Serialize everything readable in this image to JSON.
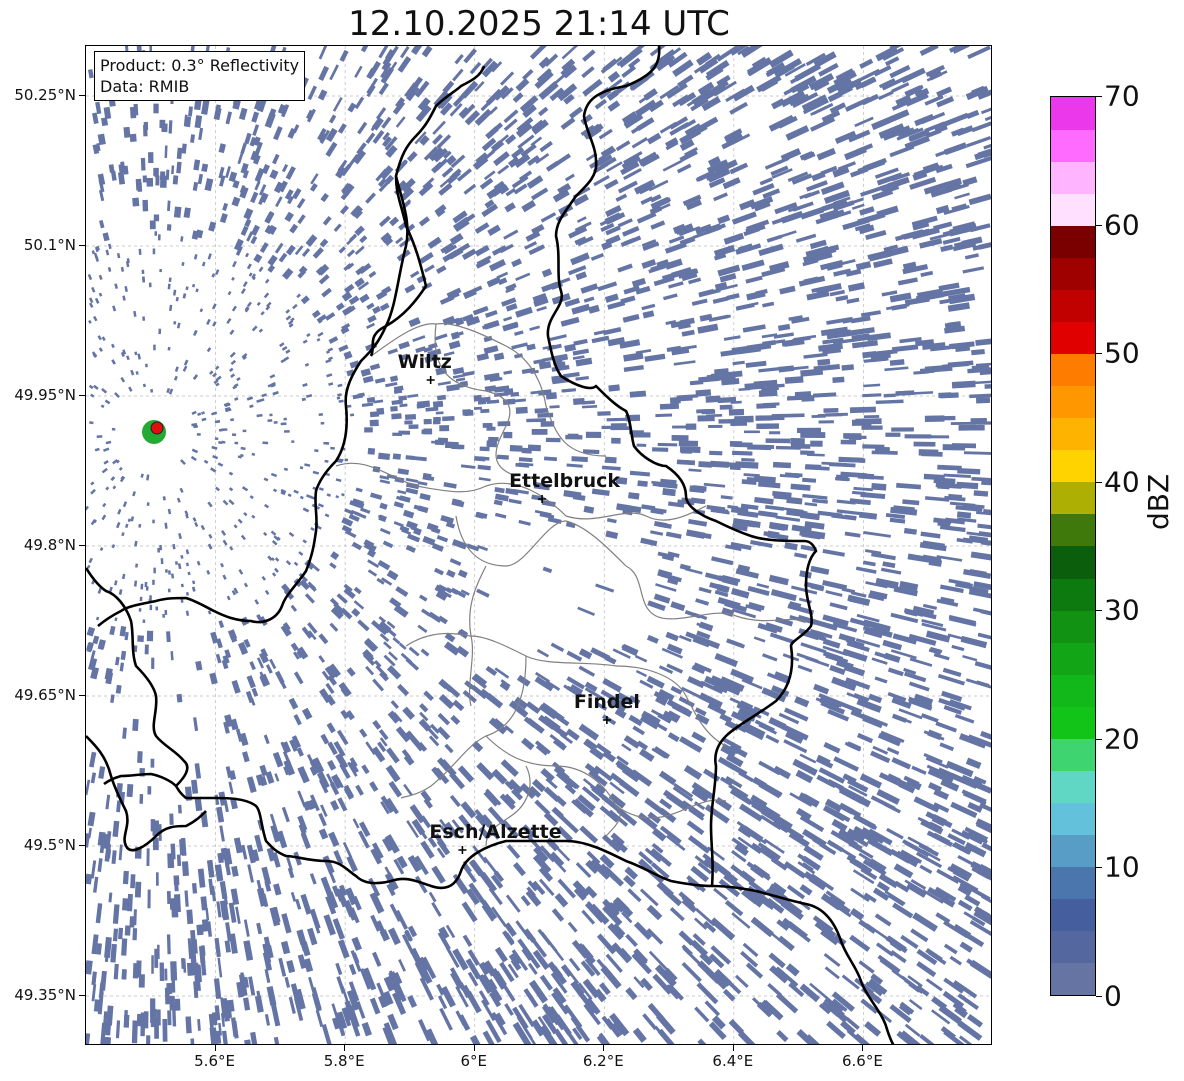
{
  "title": "12.10.2025 21:14 UTC",
  "info": {
    "product": "Product: 0.3° Reflectivity",
    "data": "Data: RMIB"
  },
  "map": {
    "lon_range": [
      5.4,
      6.8
    ],
    "lat_range": [
      49.3,
      50.3
    ],
    "lat_ticks": [
      "50.25°N",
      "50.1°N",
      "49.95°N",
      "49.8°N",
      "49.65°N",
      "49.5°N",
      "49.35°N"
    ],
    "lat_values": [
      50.25,
      50.1,
      49.95,
      49.8,
      49.65,
      49.5,
      49.35
    ],
    "lon_ticks": [
      "5.6°E",
      "5.8°E",
      "6°E",
      "6.2°E",
      "6.4°E",
      "6.6°E"
    ],
    "lon_values": [
      5.6,
      5.8,
      6.0,
      6.2,
      6.4,
      6.6
    ],
    "grid": true,
    "radar_site": {
      "lon": 5.505,
      "lat": 49.914
    },
    "cities": [
      {
        "name": "Wiltz",
        "lon": 5.932,
        "lat": 49.966
      },
      {
        "name": "Ettelbruck",
        "lon": 6.104,
        "lat": 49.847
      },
      {
        "name": "Findel",
        "lon": 6.204,
        "lat": 49.626
      },
      {
        "name": "Esch/Alzette",
        "lon": 5.981,
        "lat": 49.496
      }
    ],
    "echo_color": "#6474a4",
    "border_color": "#000000",
    "district_color": "#808080"
  },
  "colorbar": {
    "label": "dBZ",
    "min": 0,
    "max": 70,
    "tick_labels": [
      "0",
      "10",
      "20",
      "30",
      "40",
      "50",
      "60",
      "70"
    ],
    "colors": [
      "#6674a4",
      "#55679f",
      "#445e9e",
      "#4a76ad",
      "#589dc6",
      "#63c1dc",
      "#5fd7c4",
      "#3ed570",
      "#12c418",
      "#12b81a",
      "#12a516",
      "#129212",
      "#0c7a0e",
      "#0b5f0c",
      "#3f780b",
      "#adb003",
      "#fed300",
      "#feb300",
      "#fe9700",
      "#fe7d00",
      "#e00000",
      "#c10000",
      "#9f0000",
      "#7a0000",
      "#ffe1ff",
      "#ffb4ff",
      "#ff6aff",
      "#ea38ea"
    ]
  }
}
